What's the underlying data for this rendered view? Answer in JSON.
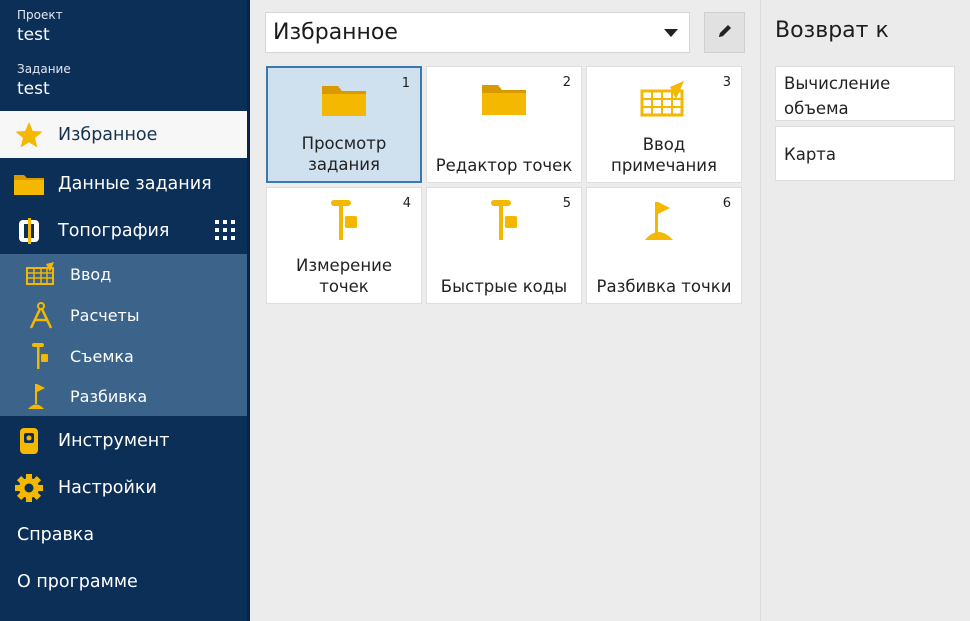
{
  "sidebar": {
    "project_label": "Проект",
    "project_value": "test",
    "job_label": "Задание",
    "job_value": "test",
    "items": [
      {
        "label": "Избранное",
        "icon": "star-icon",
        "active": true
      },
      {
        "label": "Данные задания",
        "icon": "folder-icon"
      },
      {
        "label": "Топография",
        "icon": "survey-logo-icon"
      },
      {
        "label": "Инструмент",
        "icon": "instrument-icon"
      },
      {
        "label": "Настройки",
        "icon": "gear-icon"
      },
      {
        "label": "Справка"
      },
      {
        "label": "О программе"
      }
    ],
    "sub_items": [
      {
        "label": "Ввод",
        "icon": "keypad-entry-icon"
      },
      {
        "label": "Расчеты",
        "icon": "compass-icon"
      },
      {
        "label": "Съемка",
        "icon": "rover-pole-icon"
      },
      {
        "label": "Разбивка",
        "icon": "stakeout-flag-icon"
      }
    ]
  },
  "main": {
    "favorites_select": "Избранное",
    "tiles": [
      {
        "number": "1",
        "label": "Просмотр задания",
        "icon": "folder-icon",
        "selected": true
      },
      {
        "number": "2",
        "label": "Редактор точек",
        "icon": "folder-icon"
      },
      {
        "number": "3",
        "label": "Ввод примечания",
        "icon": "note-entry-icon"
      },
      {
        "number": "4",
        "label": "Измерение точек",
        "icon": "rover-pole-icon"
      },
      {
        "number": "5",
        "label": "Быстрые коды",
        "icon": "rover-pole-icon"
      },
      {
        "number": "6",
        "label": "Разбивка точки",
        "icon": "stakeout-flag-icon"
      }
    ]
  },
  "right": {
    "title": "Возврат к",
    "items": [
      "Вычисление объема",
      "Карта"
    ]
  },
  "colors": {
    "sidebar_bg": "#0b2f57",
    "submenu_bg": "#3c6389",
    "accent_yellow": "#f5b800",
    "selected_tile": "#cfe0ef"
  }
}
